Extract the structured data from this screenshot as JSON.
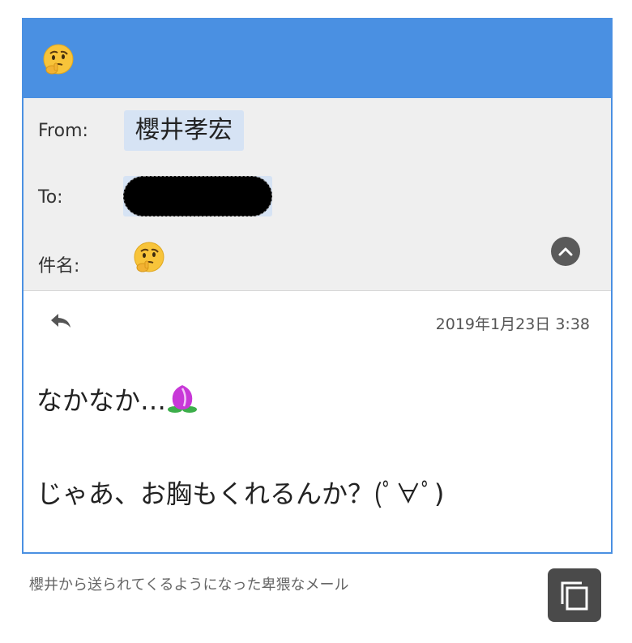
{
  "header": {
    "icon": "thinking-face-emoji"
  },
  "meta": {
    "from_label": "From:",
    "from_value": "櫻井孝宏",
    "to_label": "To:",
    "subject_label": "件名:",
    "subject_icon": "thinking-face-emoji"
  },
  "message": {
    "timestamp": "2019年1月23日 3:38",
    "line1": "なかなか…",
    "line1_icon": "peach-emoji",
    "line2": "じゃあ、お胸もくれるんか？(ﾟ∀ﾟ)"
  },
  "caption": "櫻井から送られてくるようになった卑猥なメール",
  "colors": {
    "accent": "#4a90e2",
    "meta_bg": "#efefef",
    "chip_bg": "#d6e3f4"
  }
}
